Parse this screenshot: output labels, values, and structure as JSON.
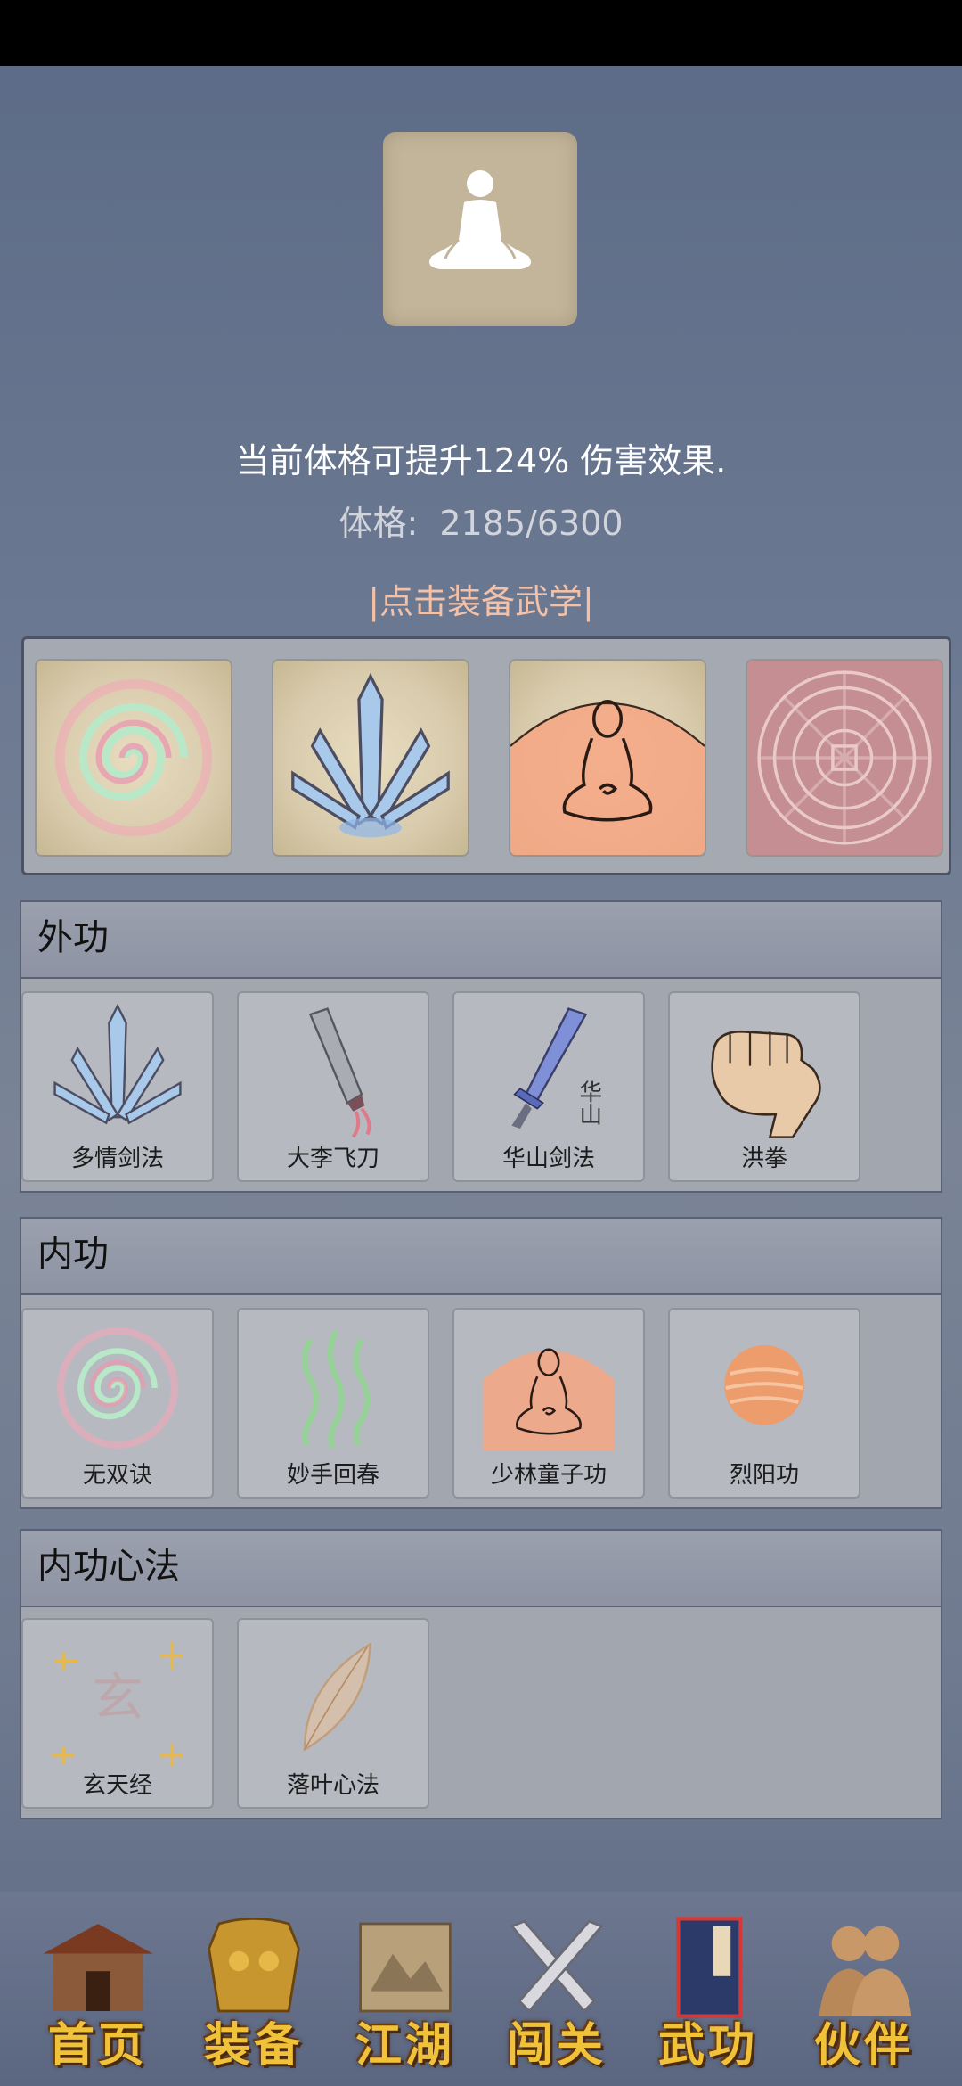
{
  "header": {
    "buff_text": "当前体格可提升124% 伤害效果.",
    "stat_label": "体格:",
    "stat_value": "2185/6300",
    "equip_link": "|点击装备武学|"
  },
  "equipped": [
    {
      "name": "无双诀",
      "icon": "spiral-icon"
    },
    {
      "name": "多情剑法",
      "icon": "crystal-blades-icon"
    },
    {
      "name": "少林童子功",
      "icon": "meditating-monk-icon"
    },
    {
      "name": "",
      "icon": "aztec-calendar-icon"
    }
  ],
  "sections": [
    {
      "title": "外功",
      "skills": [
        {
          "name": "多情剑法",
          "icon": "crystal-blades-icon"
        },
        {
          "name": "大李飞刀",
          "icon": "flying-knife-icon"
        },
        {
          "name": "华山剑法",
          "icon": "blue-sword-icon",
          "icon_text": "华山"
        },
        {
          "name": "洪拳",
          "icon": "fist-icon"
        }
      ]
    },
    {
      "title": "内功",
      "skills": [
        {
          "name": "无双诀",
          "icon": "spiral-icon"
        },
        {
          "name": "妙手回春",
          "icon": "healing-waves-icon"
        },
        {
          "name": "少林童子功",
          "icon": "meditating-monk-icon"
        },
        {
          "name": "烈阳功",
          "icon": "sun-orb-icon"
        }
      ]
    },
    {
      "title": "内功心法",
      "skills": [
        {
          "name": "玄天经",
          "icon": "xuan-scroll-icon",
          "icon_text": "玄"
        },
        {
          "name": "落叶心法",
          "icon": "leaf-icon"
        }
      ]
    }
  ],
  "bottom_nav": [
    {
      "label": "首页",
      "icon": "house-icon"
    },
    {
      "label": "装备",
      "icon": "armor-icon"
    },
    {
      "label": "江湖",
      "icon": "map-scroll-icon"
    },
    {
      "label": "闯关",
      "icon": "crossed-swords-icon"
    },
    {
      "label": "武功",
      "icon": "martial-book-icon"
    },
    {
      "label": "伙伴",
      "icon": "companions-icon"
    }
  ],
  "colors": {
    "buff_text": "#ffffff",
    "stat_text": "#d2d4dc",
    "equip_link": "#f3c1a8",
    "nav_label": "#f0c23a"
  }
}
